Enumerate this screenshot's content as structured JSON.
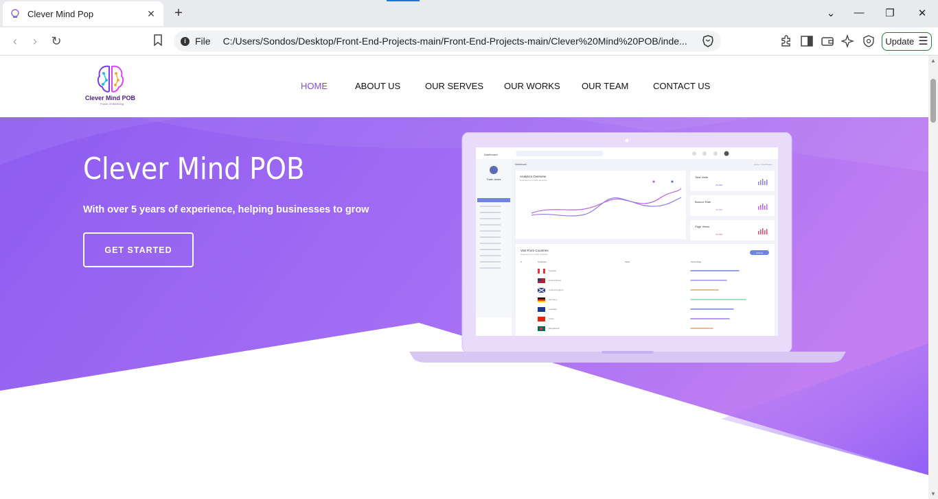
{
  "browser": {
    "tab_title": "Clever Mind Pop",
    "scheme": "File",
    "url": "C:/Users/Sondos/Desktop/Front-End-Projects-main/Front-End-Projects-main/Clever%20Mind%20POB/inde...",
    "update_label": "Update"
  },
  "site": {
    "logo_text": "Clever Mind POB",
    "logo_subtext": "Power Of Believing",
    "nav": [
      "HOME",
      "ABOUT US",
      "OUR SERVES",
      "OUR WORKS",
      "OUR TEAM",
      "CONTACT US"
    ],
    "active_nav": "HOME"
  },
  "hero": {
    "title": "Clever Mind POB",
    "subtitle": "With over 5 years of experience, helping businesses to grow",
    "cta_label": "GET STARTED"
  },
  "colors": {
    "brand_purple": "#8b5cf6",
    "hero_gradient_start": "#8e5cf0",
    "hero_gradient_end": "#c07ef2",
    "nav_active": "#7b4ee0"
  },
  "mockup": {
    "brand": "Dashboard",
    "sidebar_user": "Travis James",
    "section_header": "Dashboard",
    "breadcrumb": "Home > Dashboard",
    "chart_title": "Analytics Overview",
    "chart_subtitle": "Overview of monthly analytics",
    "stat_cards": [
      {
        "label": "Total Visits",
        "growth": "75.25%"
      },
      {
        "label": "Bounce Rate",
        "growth": "75.25%"
      },
      {
        "label": "Page Views",
        "growth": "75.25%"
      }
    ],
    "table_title": "Visit From Countries",
    "table_subtitle": "Overview of monthly analytics",
    "table_button": "Actions",
    "table_columns": [
      "#",
      "Countries",
      "Visits",
      "Percentage"
    ],
    "countries": [
      "Canada",
      "United States",
      "United Kingdom",
      "Germany",
      "Australia",
      "China",
      "Bangladesh"
    ]
  }
}
